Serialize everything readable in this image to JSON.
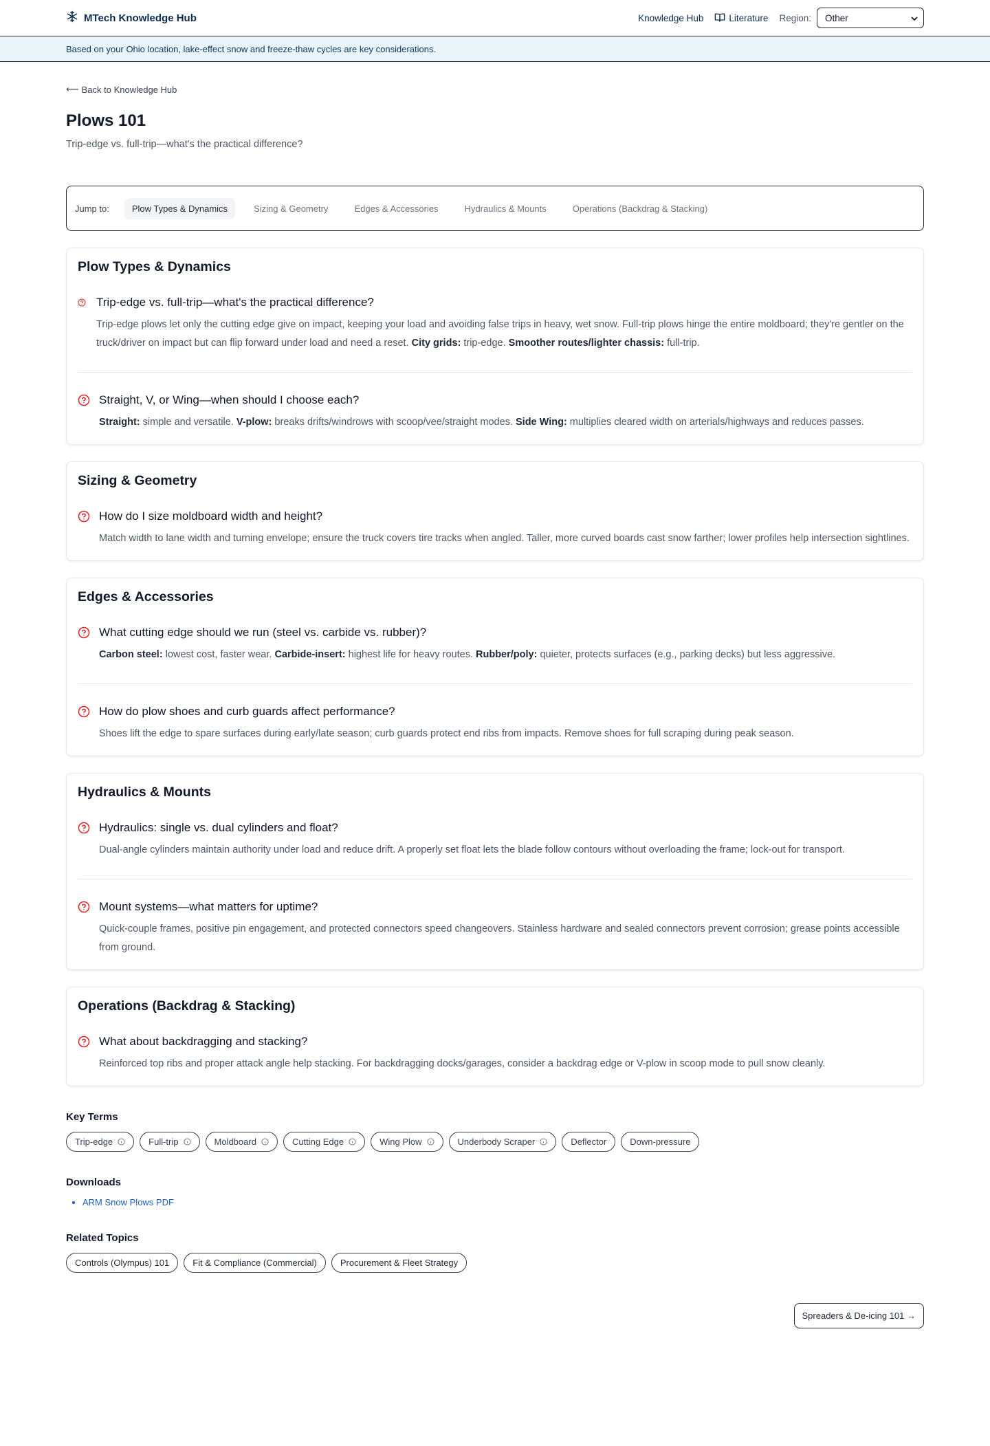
{
  "header": {
    "brand": "MTech Knowledge Hub",
    "nav_knowledge": "Knowledge Hub",
    "nav_literature": "Literature",
    "region_label": "Region:",
    "region_value": "Other"
  },
  "banner": "Based on your Ohio location, lake-effect snow and freeze-thaw cycles are key considerations.",
  "back_link": "Back to Knowledge Hub",
  "page_title": "Plows 101",
  "subtitle": "Trip-edge vs. full-trip—what's the practical difference?",
  "jump": {
    "label": "Jump to:",
    "items": [
      "Plow Types & Dynamics",
      "Sizing & Geometry",
      "Edges & Accessories",
      "Hydraulics & Mounts",
      "Operations (Backdrag & Stacking)"
    ]
  },
  "sections": [
    {
      "title": "Plow Types & Dynamics",
      "items": [
        {
          "question": "Trip-edge vs. full-trip—what's the practical difference?",
          "parts": [
            {
              "t": "Trip-edge plows let only the cutting edge give on impact, keeping your load and avoiding false trips in heavy, wet snow. Full-trip plows hinge the entire moldboard; they're gentler on the truck/driver on impact but can flip forward under load and need a reset. "
            },
            {
              "b": "City grids:"
            },
            {
              "t": " trip-edge. "
            },
            {
              "b": "Smoother routes/lighter chassis:"
            },
            {
              "t": " full-trip."
            }
          ]
        },
        {
          "question": "Straight, V, or Wing—when should I choose each?",
          "parts": [
            {
              "b": "Straight:"
            },
            {
              "t": " simple and versatile. "
            },
            {
              "b": "V-plow:"
            },
            {
              "t": " breaks drifts/windrows with scoop/vee/straight modes. "
            },
            {
              "b": "Side Wing:"
            },
            {
              "t": " multiplies cleared width on arterials/highways and reduces passes."
            }
          ]
        }
      ]
    },
    {
      "title": "Sizing & Geometry",
      "items": [
        {
          "question": "How do I size moldboard width and height?",
          "parts": [
            {
              "t": "Match width to lane width and turning envelope; ensure the truck covers tire tracks when angled. Taller, more curved boards cast snow farther; lower profiles help intersection sightlines."
            }
          ]
        }
      ]
    },
    {
      "title": "Edges & Accessories",
      "items": [
        {
          "question": "What cutting edge should we run (steel vs. carbide vs. rubber)?",
          "parts": [
            {
              "b": "Carbon steel:"
            },
            {
              "t": " lowest cost, faster wear. "
            },
            {
              "b": "Carbide-insert:"
            },
            {
              "t": " highest life for heavy routes. "
            },
            {
              "b": "Rubber/poly:"
            },
            {
              "t": " quieter, protects surfaces (e.g., parking decks) but less aggressive."
            }
          ]
        },
        {
          "question": "How do plow shoes and curb guards affect performance?",
          "parts": [
            {
              "t": "Shoes lift the edge to spare surfaces during early/late season; curb guards protect end ribs from impacts. Remove shoes for full scraping during peak season."
            }
          ]
        }
      ]
    },
    {
      "title": "Hydraulics & Mounts",
      "items": [
        {
          "question": "Hydraulics: single vs. dual cylinders and float?",
          "parts": [
            {
              "t": "Dual-angle cylinders maintain authority under load and reduce drift. A properly set float lets the blade follow contours without overloading the frame; lock-out for transport."
            }
          ]
        },
        {
          "question": "Mount systems—what matters for uptime?",
          "parts": [
            {
              "t": "Quick-couple frames, positive pin engagement, and protected connectors speed changeovers. Stainless hardware and sealed connectors prevent corrosion; grease points accessible from ground."
            }
          ]
        }
      ]
    },
    {
      "title": "Operations (Backdrag & Stacking)",
      "items": [
        {
          "question": "What about backdragging and stacking?",
          "parts": [
            {
              "t": "Reinforced top ribs and proper attack angle help stacking. For backdragging docks/garages, consider a backdrag edge or V-plow in scoop mode to pull snow cleanly."
            }
          ]
        }
      ]
    }
  ],
  "key_terms": {
    "title": "Key Terms",
    "items": [
      {
        "label": "Trip-edge",
        "info": true
      },
      {
        "label": "Full-trip",
        "info": true
      },
      {
        "label": "Moldboard",
        "info": true
      },
      {
        "label": "Cutting Edge",
        "info": true
      },
      {
        "label": "Wing Plow",
        "info": true
      },
      {
        "label": "Underbody Scraper",
        "info": true
      },
      {
        "label": "Deflector",
        "info": false
      },
      {
        "label": "Down-pressure",
        "info": false
      }
    ]
  },
  "downloads": {
    "title": "Downloads",
    "items": [
      "ARM Snow Plows PDF"
    ]
  },
  "related": {
    "title": "Related Topics",
    "items": [
      "Controls (Olympus) 101",
      "Fit & Compliance (Commercial)",
      "Procurement & Fleet Strategy"
    ]
  },
  "next_button": "Spreaders & De-icing 101 →",
  "colors": {
    "brand": "#0b2e4f",
    "accent_red": "#dc2626",
    "link_blue": "#1d5fbf",
    "banner_bg": "#eaf4fb"
  }
}
